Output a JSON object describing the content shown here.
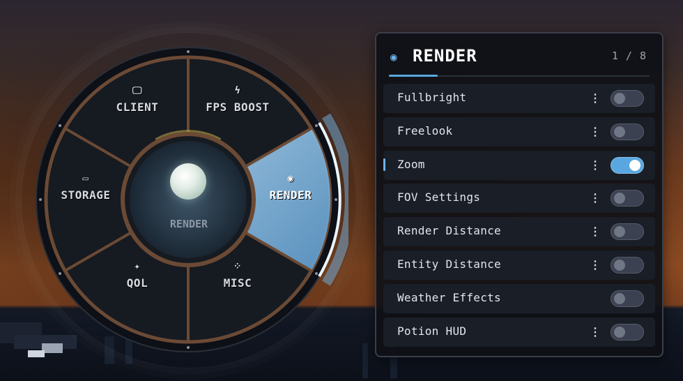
{
  "wheel": {
    "center_label": "RENDER",
    "segments": [
      {
        "label": "CLIENT",
        "icon": "monitor-icon",
        "glyph": "🖵"
      },
      {
        "label": "FPS BOOST",
        "icon": "lightning-icon",
        "glyph": "ϟ"
      },
      {
        "label": "RENDER",
        "icon": "eye-icon",
        "glyph": "◉"
      },
      {
        "label": "MISC",
        "icon": "grid-dots-icon",
        "glyph": "⁘"
      },
      {
        "label": "QOL",
        "icon": "sparkle-icon",
        "glyph": "✦"
      },
      {
        "label": "STORAGE",
        "icon": "box-icon",
        "glyph": "▭"
      }
    ],
    "active_segment": "RENDER"
  },
  "panel": {
    "title": "RENDER",
    "title_icon": "eye-icon",
    "title_glyph": "◉",
    "count": "1 / 8",
    "items": [
      {
        "label": "Fullbright",
        "enabled": false,
        "has_options": true,
        "selected": false
      },
      {
        "label": "Freelook",
        "enabled": false,
        "has_options": true,
        "selected": false
      },
      {
        "label": "Zoom",
        "enabled": true,
        "has_options": true,
        "selected": true
      },
      {
        "label": "FOV Settings",
        "enabled": false,
        "has_options": true,
        "selected": false
      },
      {
        "label": "Render Distance",
        "enabled": false,
        "has_options": true,
        "selected": false
      },
      {
        "label": "Entity Distance",
        "enabled": false,
        "has_options": true,
        "selected": false
      },
      {
        "label": "Weather Effects",
        "enabled": false,
        "has_options": false,
        "selected": false
      },
      {
        "label": "Potion HUD",
        "enabled": false,
        "has_options": true,
        "selected": false
      }
    ],
    "kebab_glyph": "⋮"
  },
  "colors": {
    "accent": "#5aa6e0",
    "wheel_rim": "#6b4a35",
    "segment_fill": "#161a21",
    "active_fill": "#6fa9d6"
  }
}
